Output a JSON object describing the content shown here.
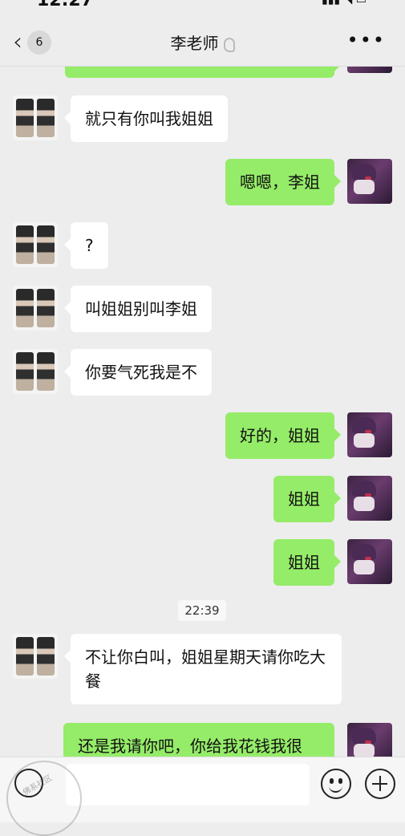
{
  "status": {
    "time": "12:27",
    "signal": "▮▮▮ ◥ ▭"
  },
  "header": {
    "back_badge": "6",
    "title": "李老师",
    "more": "•••"
  },
  "messages": [
    {
      "side": "out",
      "text": ""
    },
    {
      "side": "in",
      "text": "就只有你叫我姐姐"
    },
    {
      "side": "out",
      "text": "嗯嗯，李姐"
    },
    {
      "side": "in",
      "text": "?"
    },
    {
      "side": "in",
      "text": "叫姐姐别叫李姐"
    },
    {
      "side": "in",
      "text": "你要气死我是不"
    },
    {
      "side": "out",
      "text": "好的，姐姐"
    },
    {
      "side": "out",
      "text": "姐姐"
    },
    {
      "side": "out",
      "text": "姐姐"
    },
    {
      "timestamp": "22:39"
    },
    {
      "side": "in",
      "text": "不让你白叫，姐姐星期天请你吃大餐"
    },
    {
      "side": "out",
      "text": "还是我请你吧，你给我花钱我很"
    }
  ],
  "watermark": {
    "text": "佛系社区"
  },
  "icons": {
    "back": "chevron-left-icon",
    "voice": "voice-icon",
    "emoji": "emoji-icon",
    "plus": "plus-icon",
    "ear": "ear-icon"
  }
}
